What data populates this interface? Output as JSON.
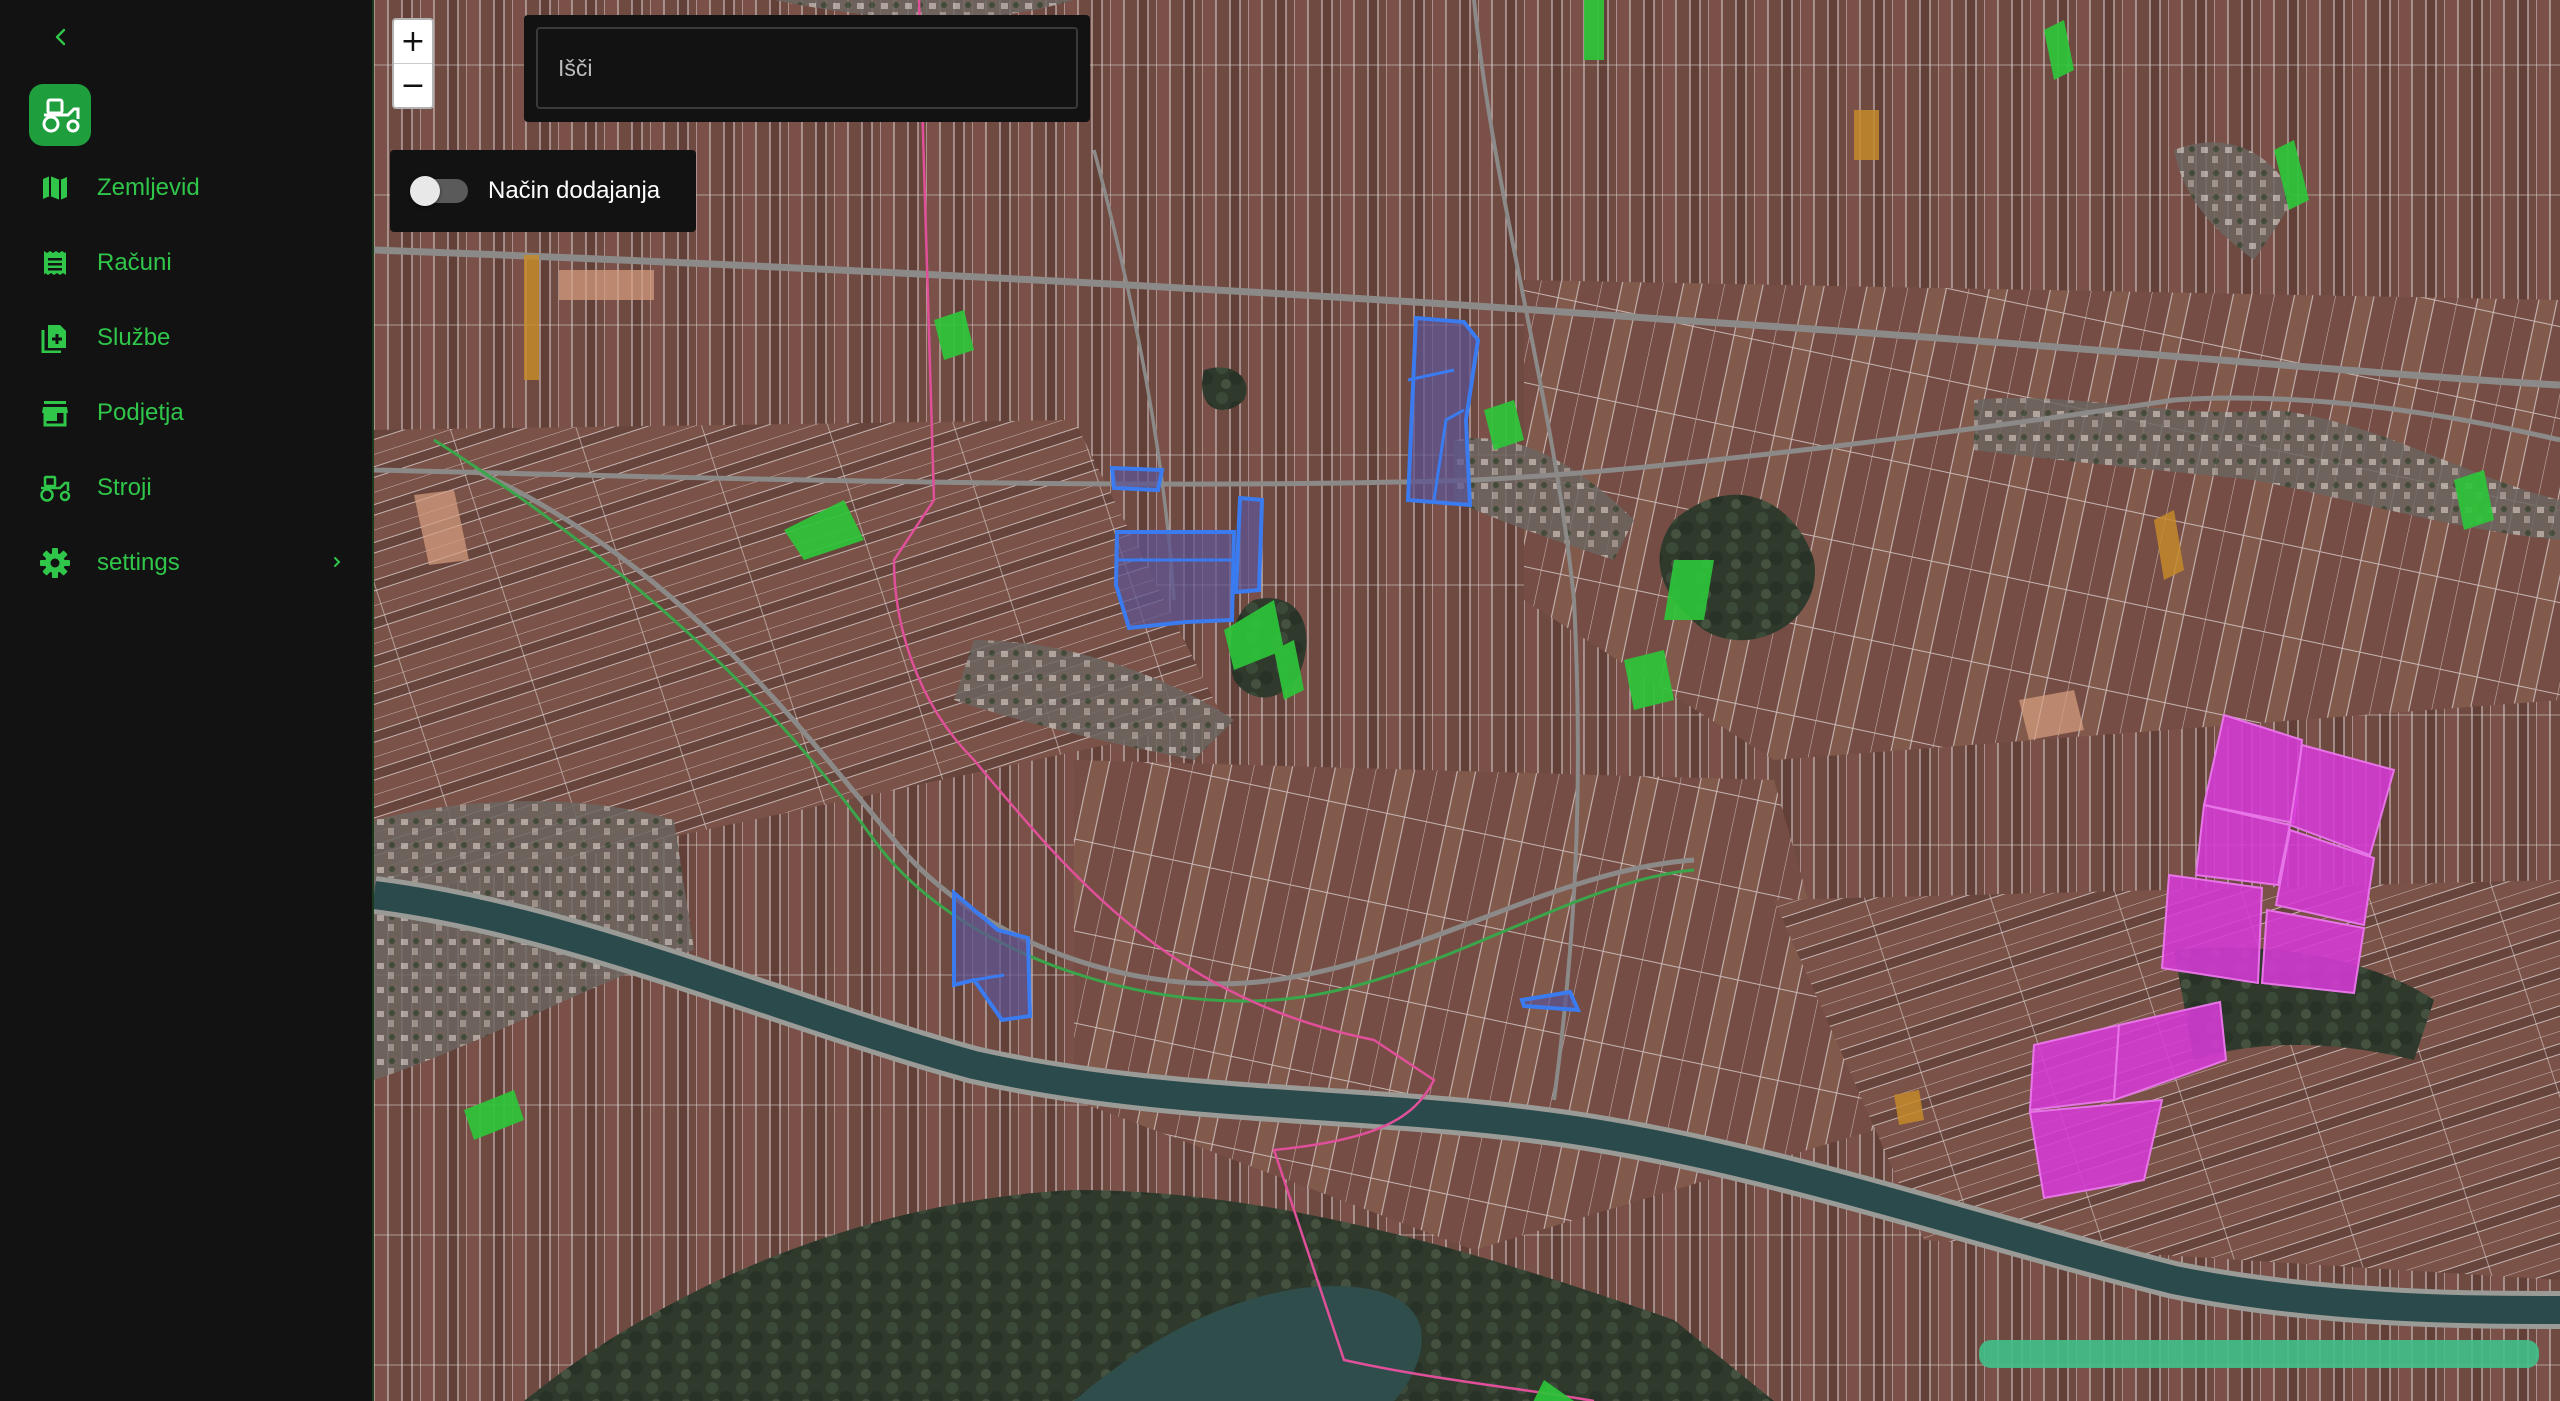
{
  "sidebar": {
    "collapse_icon": "chevron-left-icon",
    "logo_icon": "tractor-icon",
    "items": [
      {
        "label": "Zemljevid",
        "icon": "map-icon"
      },
      {
        "label": "Računi",
        "icon": "receipt-icon"
      },
      {
        "label": "Službe",
        "icon": "note-add-icon"
      },
      {
        "label": "Podjetja",
        "icon": "store-icon"
      },
      {
        "label": "Stroji",
        "icon": "tractor-icon"
      },
      {
        "label": "settings",
        "icon": "gear-icon",
        "expandable": true
      }
    ]
  },
  "map": {
    "zoom_in": "+",
    "zoom_out": "−",
    "search": {
      "placeholder": "Išči",
      "value": ""
    },
    "add_mode": {
      "label": "Način dodajanja",
      "enabled": false
    }
  },
  "colors": {
    "accent": "#2fc64a",
    "sidebar_bg": "#121212",
    "field_selected": "#3b7bf0",
    "field_magenta": "#d63ad6",
    "field_green": "#2ec43a",
    "boundary_pink": "#e0509a"
  }
}
